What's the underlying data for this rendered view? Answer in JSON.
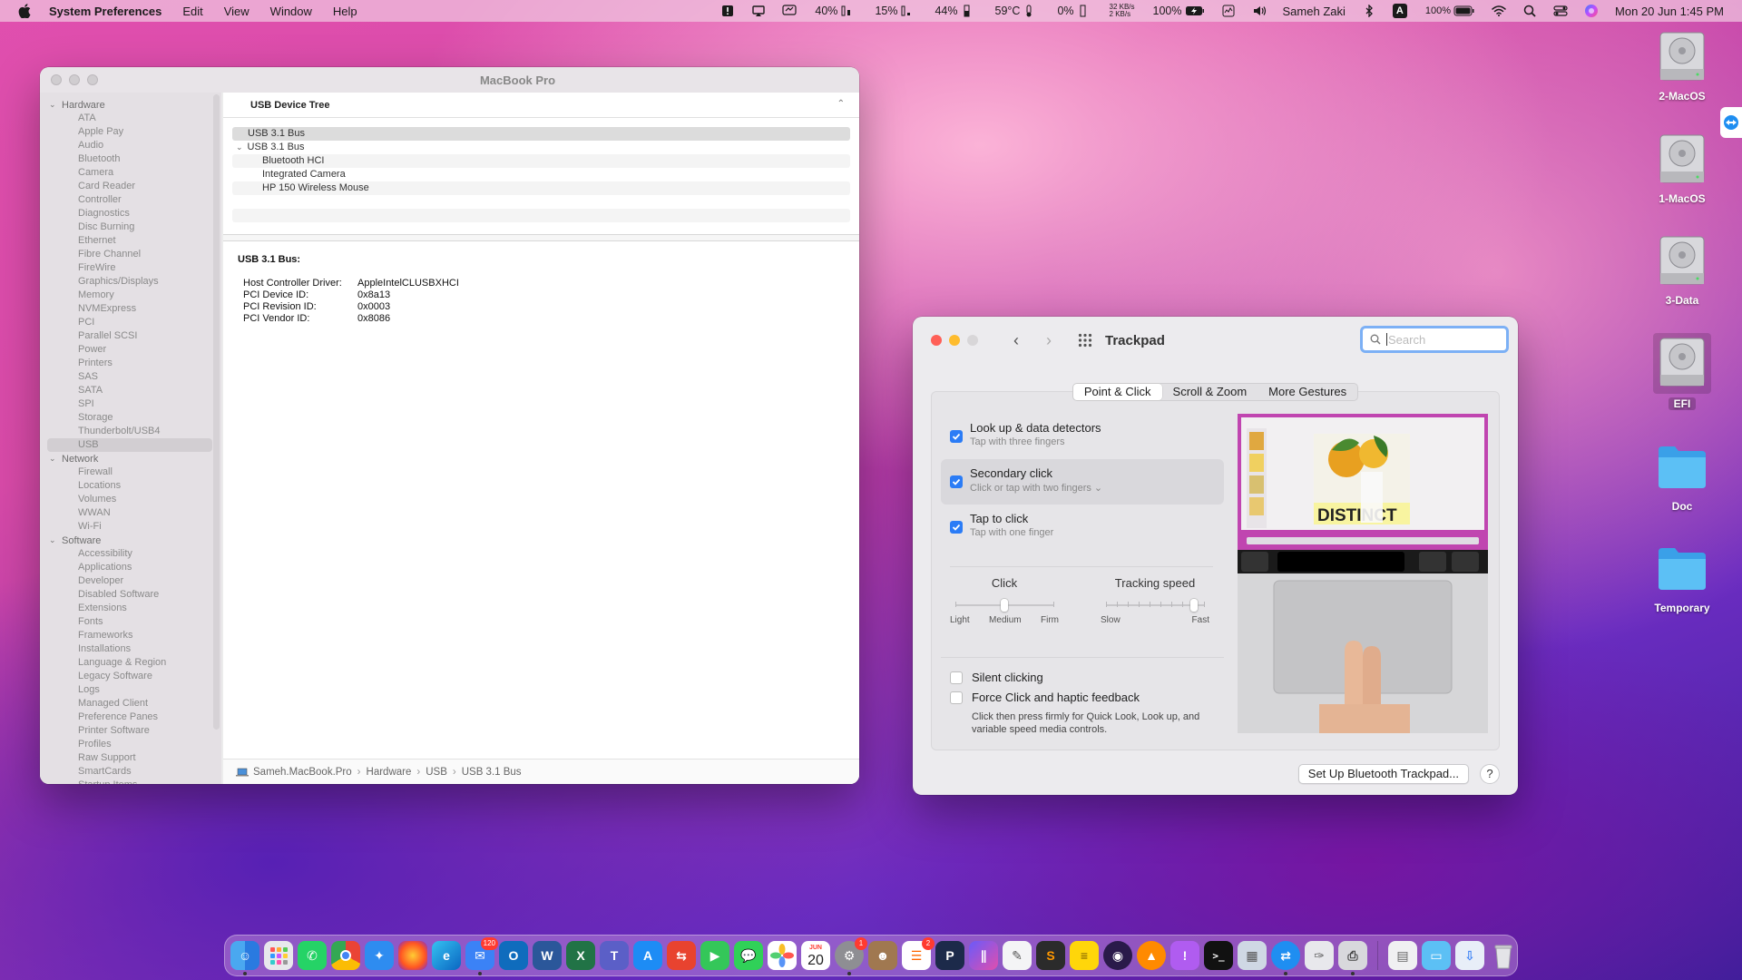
{
  "menubar": {
    "app_name": "System Preferences",
    "menus": [
      "Edit",
      "View",
      "Window",
      "Help"
    ],
    "stats": [
      {
        "label": "40%"
      },
      {
        "label": "15%"
      },
      {
        "label": "44%"
      },
      {
        "label": "59°C"
      },
      {
        "label": "0%"
      }
    ],
    "net_up": "32 KB/s",
    "net_down": "2 KB/s",
    "battery_a": "100%",
    "user": "Sameh Zaki",
    "input_letter": "A",
    "battery_b": "100%",
    "clock": "Mon 20 Jun  1:45 PM"
  },
  "sysinfo": {
    "title": "MacBook Pro",
    "sidebar": {
      "hardware_label": "Hardware",
      "hardware": [
        "ATA",
        "Apple Pay",
        "Audio",
        "Bluetooth",
        "Camera",
        "Card Reader",
        "Controller",
        "Diagnostics",
        "Disc Burning",
        "Ethernet",
        "Fibre Channel",
        "FireWire",
        "Graphics/Displays",
        "Memory",
        "NVMExpress",
        "PCI",
        "Parallel SCSI",
        "Power",
        "Printers",
        "SAS",
        "SATA",
        "SPI",
        "Storage",
        "Thunderbolt/USB4",
        "USB"
      ],
      "network_label": "Network",
      "network": [
        "Firewall",
        "Locations",
        "Volumes",
        "WWAN",
        "Wi-Fi"
      ],
      "software_label": "Software",
      "software": [
        "Accessibility",
        "Applications",
        "Developer",
        "Disabled Software",
        "Extensions",
        "Fonts",
        "Frameworks",
        "Installations",
        "Language & Region",
        "Legacy Software",
        "Logs",
        "Managed Client",
        "Preference Panes",
        "Printer Software",
        "Profiles",
        "Raw Support",
        "SmartCards",
        "Startup Items"
      ]
    },
    "tree_header": "USB Device Tree",
    "tree": {
      "row0": "USB 3.1 Bus",
      "row1": "USB 3.1 Bus",
      "row2": "Bluetooth HCI",
      "row3": "Integrated Camera",
      "row4": "HP 150 Wireless Mouse"
    },
    "detail": {
      "heading": "USB 3.1 Bus:",
      "rows": [
        {
          "k": "Host Controller Driver:",
          "v": "AppleIntelCLUSBXHCI"
        },
        {
          "k": "PCI Device ID:",
          "v": "0x8a13"
        },
        {
          "k": "PCI Revision ID:",
          "v": "0x0003"
        },
        {
          "k": "PCI Vendor ID:",
          "v": "0x8086"
        }
      ]
    },
    "path": [
      "Sameh.MacBook.Pro",
      "Hardware",
      "USB",
      "USB 3.1 Bus"
    ]
  },
  "trackpad": {
    "title": "Trackpad",
    "search_placeholder": "Search",
    "tabs": [
      "Point & Click",
      "Scroll & Zoom",
      "More Gestures"
    ],
    "options": [
      {
        "title": "Look up & data detectors",
        "sub": "Tap with three fingers"
      },
      {
        "title": "Secondary click",
        "sub": "Click or tap with two fingers ⌄"
      },
      {
        "title": "Tap to click",
        "sub": "Tap with one finger"
      }
    ],
    "click_slider": {
      "label": "Click",
      "min": "Light",
      "mid": "Medium",
      "max": "Firm",
      "value": 0.5
    },
    "speed_slider": {
      "label": "Tracking speed",
      "min": "Slow",
      "max": "Fast",
      "value": 0.9
    },
    "silent_clicking": "Silent clicking",
    "force_click": "Force Click and haptic feedback",
    "force_desc": "Click then press firmly for Quick Look, Look up, and variable speed media controls.",
    "preview_text": "DISTINCT",
    "setup_button": "Set Up Bluetooth Trackpad...",
    "help": "?"
  },
  "desktop": {
    "icons": [
      "2-MacOS",
      "1-MacOS",
      "3-Data",
      "EFI",
      "Doc",
      "Temporary"
    ]
  },
  "dock": {
    "mail_badge": "120",
    "calendar_month": "JUN",
    "calendar_day": "20",
    "prefs_badge": "1",
    "reminders_badge": "2"
  }
}
